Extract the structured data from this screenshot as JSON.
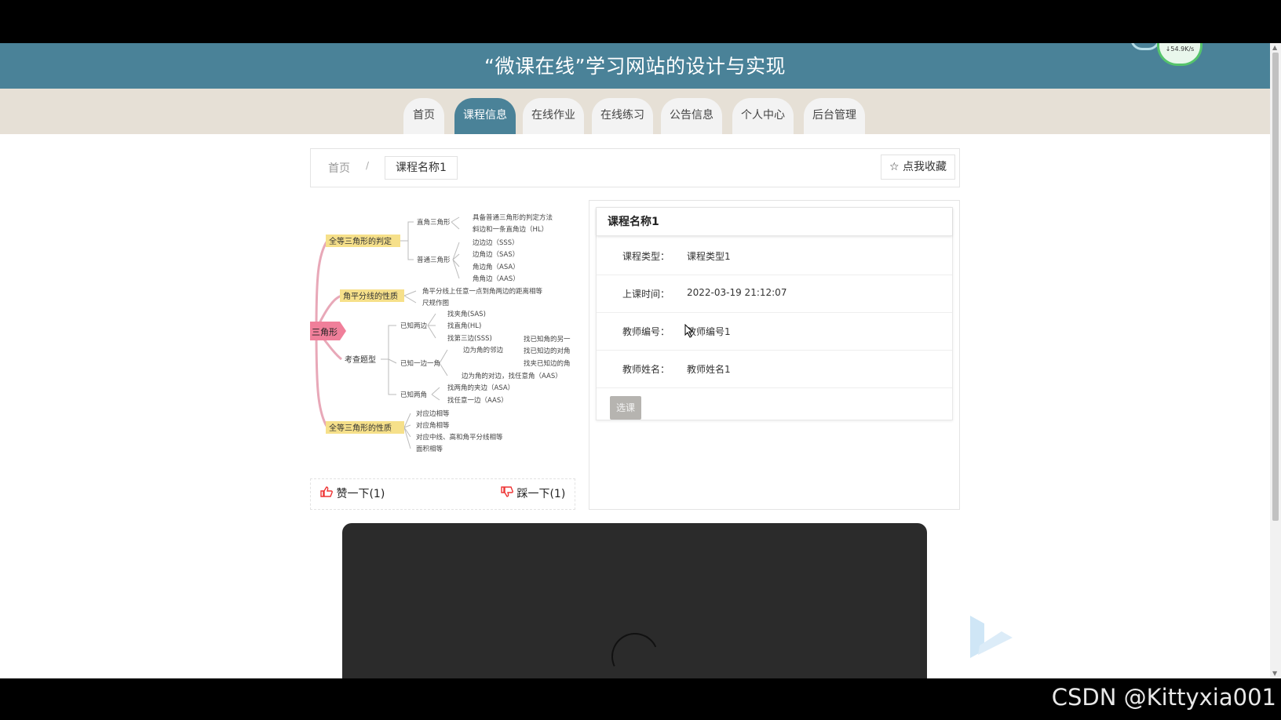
{
  "header": {
    "title": "“微课在线”学习网站的设计与实现",
    "speed": "↓54.9K/s"
  },
  "nav": {
    "items": [
      "首页",
      "课程信息",
      "在线作业",
      "在线练习",
      "公告信息",
      "个人中心",
      "后台管理"
    ],
    "active": "课程信息"
  },
  "breadcrumb": {
    "home": "首页",
    "sep": "/",
    "current": "课程名称1",
    "favorite": "☆ 点我收藏"
  },
  "mindmap": {
    "center": "三角形",
    "branches": [
      "全等三角形的判定",
      "角平分线的性质",
      "考查题型",
      "全等三角形的性质"
    ],
    "leaves": [
      "直角三角形",
      "普通三角形",
      "具备普通三角形的判定方法",
      "斜边和一条直角边（HL）",
      "边边边（SSS）",
      "边角边（SAS）",
      "角边角（ASA）",
      "角角边（AAS）",
      "角平分线上任意一点到角两边的距离相等",
      "尺规作图",
      "已知两边",
      "已知一边一角",
      "已知两角",
      "找夹角(SAS)",
      "找直角(HL)",
      "找第三边(SSS)",
      "边为角的邻边",
      "边为角的对边，找任意角（AAS）",
      "找已知角的另一",
      "找已知边的对角",
      "找夹已知边的角",
      "找两角的夹边（ASA）",
      "找任意一边（AAS）",
      "对应边相等",
      "对应角相等",
      "对应中线、高和角平分线相等",
      "面积相等"
    ]
  },
  "likes": {
    "like": "赞一下(1)",
    "dislike": "踩一下(1)"
  },
  "course": {
    "name": "课程名称1",
    "rows": [
      {
        "label": "课程类型：",
        "value": "课程类型1"
      },
      {
        "label": "上课时间：",
        "value": "2022-03-19 21:12:07"
      },
      {
        "label": "教师编号：",
        "value": "教师编号1"
      },
      {
        "label": "教师姓名：",
        "value": "教师姓名1"
      }
    ],
    "select_button": "选课"
  },
  "watermark": "CSDN @Kittyxia001"
}
